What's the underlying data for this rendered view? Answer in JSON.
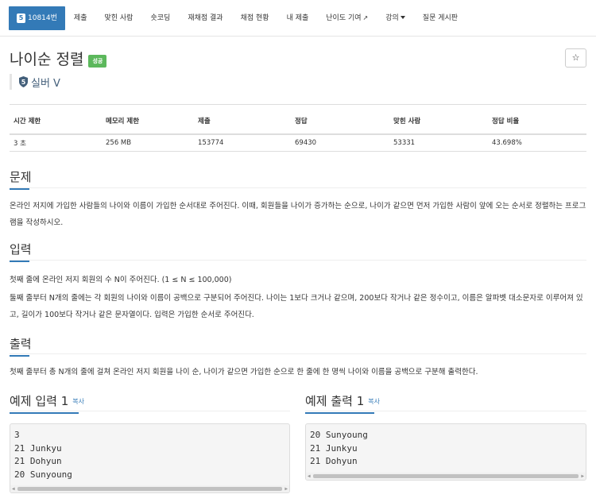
{
  "nav": {
    "problem_tier": "5",
    "problem_id": "10814번",
    "items": [
      "제출",
      "맞힌 사람",
      "숏코딩",
      "재채점 결과",
      "채점 현황",
      "내 제출",
      "난이도 기여",
      "강의",
      "질문 게시판"
    ]
  },
  "problem": {
    "title": "나이순 정렬",
    "badge": "성공",
    "tier": "실버 V",
    "tier_level": "5",
    "star": "☆"
  },
  "info": {
    "headers": [
      "시간 제한",
      "메모리 제한",
      "제출",
      "정답",
      "맞힌 사람",
      "정답 비율"
    ],
    "values": [
      "3 초",
      "256 MB",
      "153774",
      "69430",
      "53331",
      "43.698%"
    ]
  },
  "sections": {
    "problem_head": "문제",
    "problem_text": "온라인 저지에 가입한 사람들의 나이와 이름이 가입한 순서대로 주어진다. 이때, 회원들을 나이가 증가하는 순으로, 나이가 같으면 먼저 가입한 사람이 앞에 오는 순서로 정렬하는 프로그램을 작성하시오.",
    "input_head": "입력",
    "input_text_1": "첫째 줄에 온라인 저지 회원의 수 N이 주어진다. (1 ≤ N ≤ 100,000)",
    "input_text_2": "둘째 줄부터 N개의 줄에는 각 회원의 나이와 이름이 공백으로 구분되어 주어진다. 나이는 1보다 크거나 같으며, 200보다 작거나 같은 정수이고, 이름은 알파벳 대소문자로 이루어져 있고, 길이가 100보다 작거나 같은 문자열이다. 입력은 가입한 순서로 주어진다.",
    "output_head": "출력",
    "output_text": "첫째 줄부터 총 N개의 줄에 걸쳐 온라인 저지 회원을 나이 순, 나이가 같으면 가입한 순으로 한 줄에 한 명씩 나이와 이름을 공백으로 구분해 출력한다."
  },
  "samples": {
    "input_head": "예제 입력 1",
    "output_head": "예제 출력 1",
    "copy_label": "복사",
    "input_lines": [
      "3",
      "21 Junkyu",
      "21 Dohyun",
      "20 Sunyoung"
    ],
    "output_lines": [
      "20 Sunyoung",
      "21 Junkyu",
      "21 Dohyun"
    ]
  },
  "colors": {
    "primary": "#337ab7",
    "success": "#5cb85c",
    "tier_silver": "#435f7a"
  }
}
